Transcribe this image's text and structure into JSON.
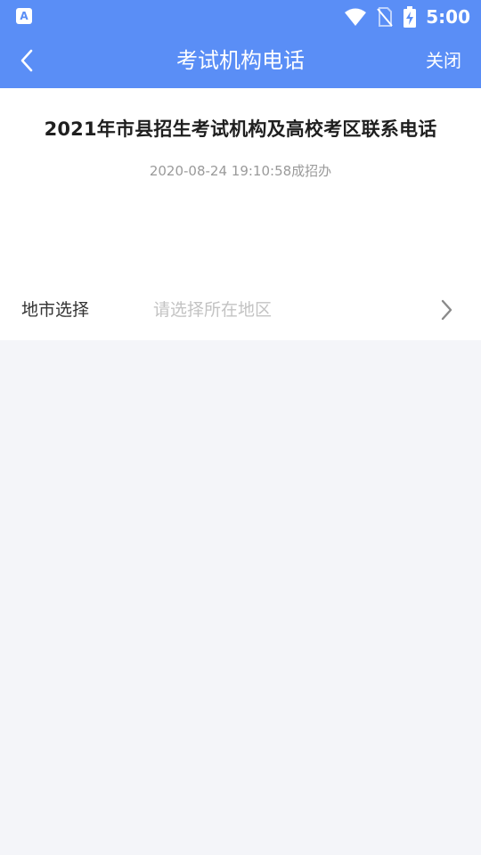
{
  "status_bar": {
    "left_icon_letter": "A",
    "time": "5:00",
    "icons": [
      "app-notification-icon",
      "wifi-icon",
      "no-sim-icon",
      "battery-charging-icon"
    ]
  },
  "header": {
    "title": "考试机构电话",
    "close_label": "关闭",
    "back_icon": "chevron-left-icon"
  },
  "article": {
    "title": "2021年市县招生考试机构及高校考区联系电话",
    "meta": "2020-08-24 19:10:58成招办"
  },
  "region_select": {
    "label": "地市选择",
    "placeholder": "请选择所在地区",
    "arrow_icon": "chevron-right-icon"
  },
  "colors": {
    "header_blue": "#5a8ef6",
    "background": "#f4f5f9",
    "card": "#ffffff"
  }
}
